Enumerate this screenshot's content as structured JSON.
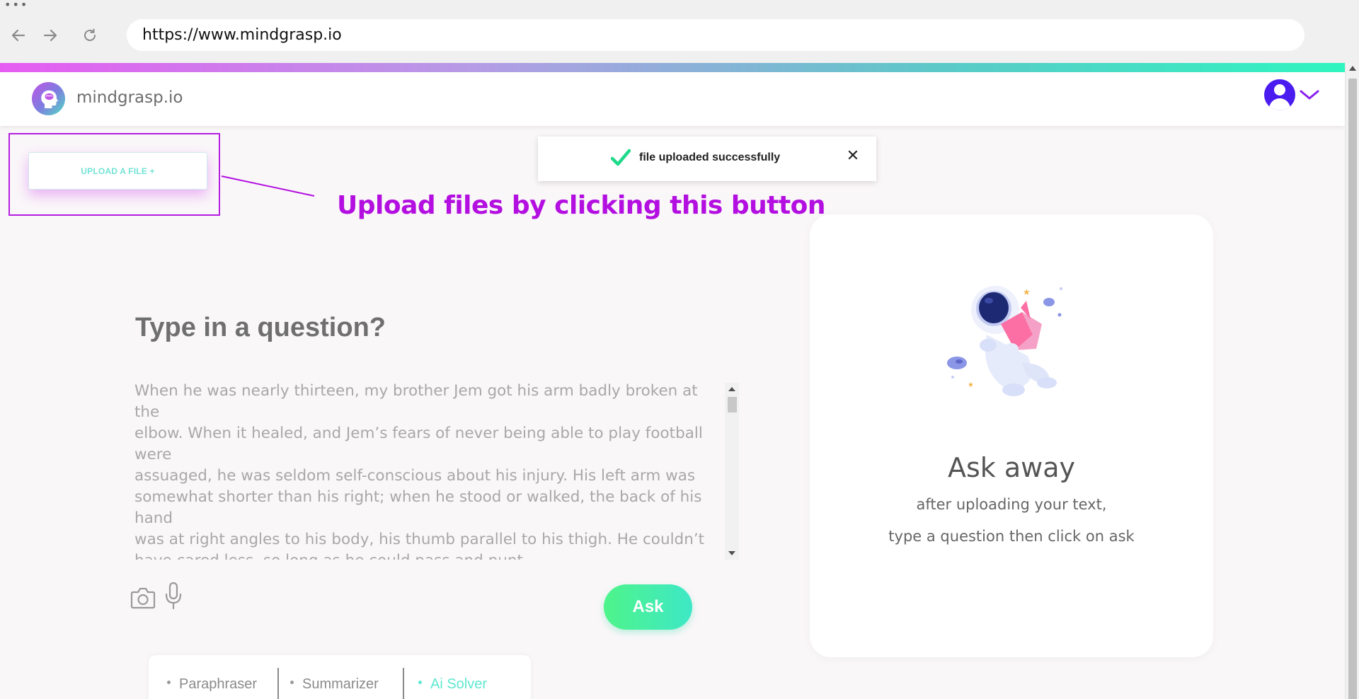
{
  "browser": {
    "url": "https://www.mindgrasp.io"
  },
  "header": {
    "brand": "mindgrasp.io"
  },
  "upload": {
    "button_label": "UPLOAD A FILE +",
    "annotation": "Upload files by clicking this button"
  },
  "toast": {
    "message": "file uploaded successfully",
    "close_label": "✕"
  },
  "question": {
    "title": "Type in a question?",
    "text_lines": [
      "When he was nearly thirteen, my brother Jem got his arm badly broken at",
      "the",
      "elbow. When it healed, and Jem’s fears of never being able to play football",
      "were",
      "assuaged, he was seldom self-conscious about his injury. His left arm was",
      "somewhat shorter than his right; when he stood or walked, the back of his",
      "hand",
      "was at right angles to his body, his thumb parallel to his thigh. He couldn’t",
      "have cared less, so long as he could pass and punt."
    ],
    "ask_label": "Ask"
  },
  "tools": {
    "tabs": [
      {
        "label": "Paraphraser",
        "active": false
      },
      {
        "label": "Summarizer",
        "active": false
      },
      {
        "label": "Ai Solver",
        "active": true
      }
    ]
  },
  "card": {
    "title": "Ask away",
    "line1": "after uploading your text,",
    "line2": "type a question then click on ask"
  },
  "colors": {
    "accent_purple": "#b30fe0",
    "accent_green": "#4ef48a",
    "accent_teal": "#5ee8d0",
    "avatar_blue": "#4b1cf0"
  },
  "icons": [
    "back-arrow-icon",
    "forward-arrow-icon",
    "reload-icon",
    "brain-logo-icon",
    "user-icon",
    "chevron-down-icon",
    "check-icon",
    "close-icon",
    "camera-icon",
    "microphone-icon"
  ]
}
